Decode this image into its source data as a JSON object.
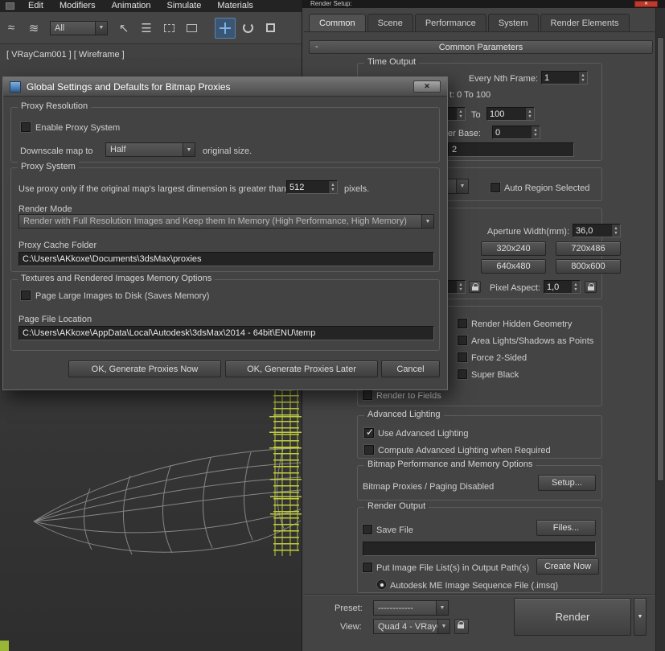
{
  "colors": {
    "accent_blue": "#7db2e8",
    "wireframe": "#8f8f8f",
    "tower_yellow": "#c9d63e",
    "close_red": "#c0392b"
  },
  "icons": {
    "chevron_down": "▼",
    "spinner_up": "▲",
    "spinner_down": "▼",
    "close": "✕",
    "check": "✓",
    "wave": "≈",
    "select_arrow": "↖",
    "list": "☰"
  },
  "menubar": {
    "items": [
      "Edit",
      "Modifiers",
      "Animation",
      "Simulate",
      "Materials"
    ]
  },
  "toolbar": {
    "selection_filter": "All"
  },
  "viewport": {
    "label": "[ VRayCam001 ] [ Wireframe ]"
  },
  "proxies_dialog": {
    "title": "Global Settings and Defaults for Bitmap Proxies",
    "proxy_resolution": {
      "group_label": "Proxy Resolution",
      "enable_checkbox": "Enable Proxy System",
      "downscale_label": "Downscale map to",
      "downscale_value": "Half",
      "downscale_suffix": "original size."
    },
    "proxy_system": {
      "group_label": "Proxy System",
      "threshold_label": "Use proxy only if the original map's largest dimension is greater than",
      "threshold_value": "512",
      "threshold_suffix": "pixels.",
      "render_mode_label": "Render Mode",
      "render_mode_value": "Render with Full Resolution Images and Keep them In Memory (High Performance, High Memory)",
      "cache_folder_label": "Proxy Cache Folder",
      "cache_folder_value": "C:\\Users\\AKkoxe\\Documents\\3dsMax\\proxies"
    },
    "memory_options": {
      "group_label": "Textures and Rendered Images Memory Options",
      "page_checkbox": "Page Large Images to Disk (Saves Memory)",
      "page_file_label": "Page File Location",
      "page_file_value": "C:\\Users\\AKkoxe\\AppData\\Local\\Autodesk\\3dsMax\\2014 - 64bit\\ENU\\temp"
    },
    "buttons": {
      "ok_now": "OK, Generate Proxies Now",
      "ok_later": "OK, Generate Proxies Later",
      "cancel": "Cancel"
    }
  },
  "render_setup": {
    "window_title": "Render Setup:",
    "tabs": [
      "Common",
      "Scene",
      "Performance",
      "System",
      "Render Elements"
    ],
    "rollout_title": "Common Parameters",
    "rollout_state": "-",
    "time_output": {
      "group_label": "Time Output",
      "every_nth_label": "Every Nth Frame:",
      "every_nth_value": "1",
      "segment_text": "t:   0 To 100",
      "to_label": "To",
      "to_value": "100",
      "file_base_label": "er Base:",
      "file_base_value": "0",
      "frames_value": "2"
    },
    "area_to_render": {
      "auto_region_label": "Auto Region Selected"
    },
    "output_size": {
      "aperture_label": "Aperture Width(mm):",
      "aperture_value": "36,0",
      "presets": [
        "320x240",
        "720x486",
        "640x480",
        "800x600"
      ],
      "pixel_aspect_label": "Pixel Aspect:",
      "pixel_aspect_value": "1,0"
    },
    "options": {
      "right_items": [
        "Render Hidden Geometry",
        "Area Lights/Shadows as Points",
        "Force 2-Sided",
        "Super Black"
      ],
      "render_to_fields": "Render to Fields"
    },
    "advanced_lighting": {
      "group_label": "Advanced Lighting",
      "use_label": "Use Advanced Lighting",
      "compute_label": "Compute Advanced Lighting when Required"
    },
    "bitmap_perf": {
      "group_label": "Bitmap Performance and Memory Options",
      "status": "Bitmap Proxies / Paging Disabled",
      "setup_button": "Setup..."
    },
    "render_output": {
      "group_label": "Render Output",
      "save_file": "Save File",
      "files_button": "Files...",
      "put_list": "Put Image File List(s) in Output Path(s)",
      "create_now_button": "Create Now",
      "imsq_radio": "Autodesk ME Image Sequence File (.imsq)"
    },
    "footer": {
      "preset_label": "Preset:",
      "preset_value": "------------",
      "view_label": "View:",
      "view_value": "Quad 4 - VRayC",
      "render_button": "Render"
    }
  }
}
